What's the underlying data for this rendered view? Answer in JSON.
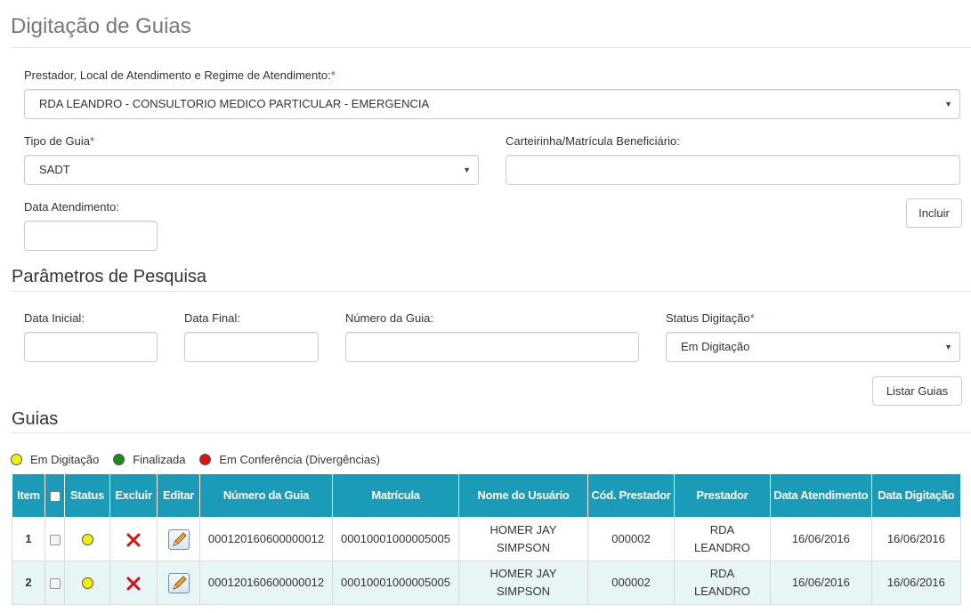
{
  "page": {
    "title": "Digitação de Guias"
  },
  "form": {
    "prestador_label": "Prestador, Local de Atendimento e Regime de Atendimento:",
    "required_mark": "*",
    "prestador_value": "RDA LEANDRO - CONSULTORIO MEDICO PARTICULAR - EMERGENCIA",
    "tipo_guia_label": "Tipo de Guia",
    "tipo_guia_value": "SADT",
    "carteirinha_label": "Carteirinha/Matrícula Beneficiário:",
    "carteirinha_value": "",
    "data_atendimento_label": "Data Atendimento:",
    "data_atendimento_value": "",
    "incluir_label": "Incluir"
  },
  "search": {
    "title": "Parâmetros de Pesquisa",
    "data_inicial_label": "Data Inicial:",
    "data_final_label": "Data Final:",
    "numero_guia_label": "Número da Guia:",
    "status_label": "Status Digitação",
    "status_value": "Em Digitação",
    "listar_label": "Listar Guias"
  },
  "guias": {
    "title": "Guias",
    "legend": [
      {
        "label": "Em Digitação",
        "color": "#f2f200"
      },
      {
        "label": "Finalizada",
        "color": "#1e8a1e"
      },
      {
        "label": "Em Conferência (Divergências)",
        "color": "#e01010"
      }
    ],
    "columns": {
      "item": "Item",
      "status": "Status",
      "excluir": "Excluir",
      "editar": "Editar",
      "numero": "Número da Guia",
      "matricula": "Matrícula",
      "nome": "Nome do Usuário",
      "cod_prestador": "Cód. Prestador",
      "prestador": "Prestador",
      "data_atendimento": "Data Atendimento",
      "data_digitacao": "Data Digitação"
    },
    "rows": [
      {
        "item": "1",
        "status_color": "#f2f200",
        "numero": "000120160600000012",
        "matricula": "00010001000005005",
        "nome": "HOMER JAY SIMPSON",
        "cod_prestador": "000002",
        "prestador": "RDA LEANDRO",
        "data_atendimento": "16/06/2016",
        "data_digitacao": "16/06/2016"
      },
      {
        "item": "2",
        "status_color": "#f2f200",
        "numero": "000120160600000012",
        "matricula": "00010001000005005",
        "nome": "HOMER JAY SIMPSON",
        "cod_prestador": "000002",
        "prestador": "RDA LEANDRO",
        "data_atendimento": "16/06/2016",
        "data_digitacao": "16/06/2016"
      }
    ]
  }
}
